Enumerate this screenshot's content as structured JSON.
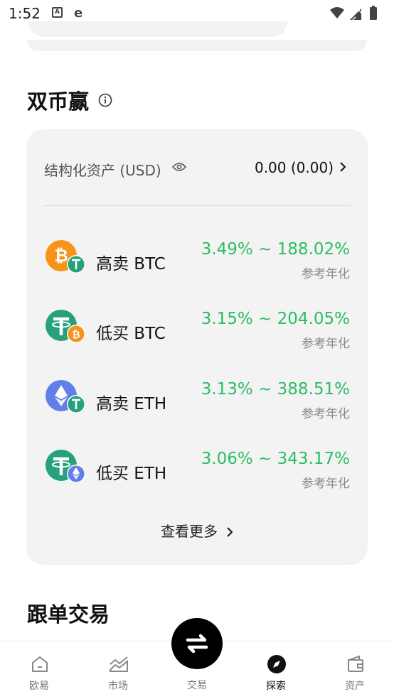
{
  "status_bar": {
    "time": "1:52",
    "app_icon_letter": "A",
    "browser_icon_letter": "e"
  },
  "dual_currency": {
    "title": "双币赢",
    "structured_assets_label": "结构化资产 (USD)",
    "structured_assets_value": "0.00 (0.00)",
    "products": [
      {
        "name": "高卖 BTC",
        "rate": "3.49% ~ 188.02%",
        "sub": "参考年化",
        "main_coin": "btc",
        "sub_coin": "usdt"
      },
      {
        "name": "低买 BTC",
        "rate": "3.15% ~ 204.05%",
        "sub": "参考年化",
        "main_coin": "usdt",
        "sub_coin": "btc"
      },
      {
        "name": "高卖 ETH",
        "rate": "3.13% ~ 388.51%",
        "sub": "参考年化",
        "main_coin": "eth",
        "sub_coin": "usdt"
      },
      {
        "name": "低买 ETH",
        "rate": "3.06% ~ 343.17%",
        "sub": "参考年化",
        "main_coin": "usdt",
        "sub_coin": "eth"
      }
    ],
    "see_more": "查看更多"
  },
  "copy_trading": {
    "title": "跟单交易"
  },
  "tab_bar": {
    "tabs": [
      {
        "label": "欧易",
        "icon": "home-icon"
      },
      {
        "label": "市场",
        "icon": "market-chart-icon"
      },
      {
        "label": "交易",
        "icon": "swap-icon"
      },
      {
        "label": "探索",
        "icon": "compass-icon",
        "active": true
      },
      {
        "label": "资产",
        "icon": "wallet-icon"
      }
    ]
  },
  "colors": {
    "rate_green": "#2bbd63",
    "btc_orange": "#f7931a",
    "usdt_green": "#26a17b",
    "eth_blue": "#627eea",
    "card_bg": "#f3f3f3"
  }
}
